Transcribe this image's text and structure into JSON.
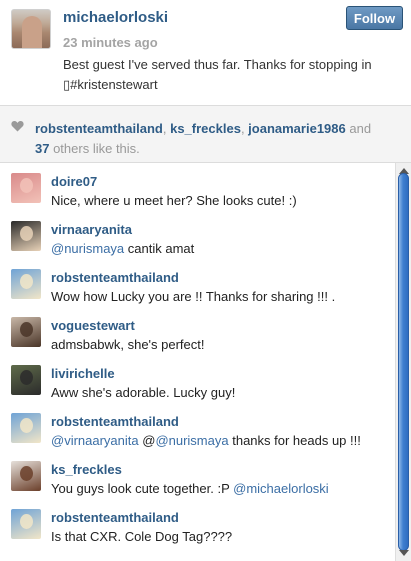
{
  "post": {
    "username": "michaelorloski",
    "time": "23 minutes ago",
    "caption": "Best guest I've served thus far. Thanks for stopping in\n▯#kristenstewart",
    "follow_label": "Follow"
  },
  "likes": {
    "users": [
      "robstenteamthailand",
      "ks_freckles",
      "joanamarie1986"
    ],
    "separator": ", ",
    "and_text": " and",
    "others_count": "37",
    "others_text": " others like this."
  },
  "comments": [
    {
      "user": "doire07",
      "parts": [
        {
          "t": "Nice, where u meet her? She looks cute! :)",
          "m": false
        }
      ],
      "avatar": {
        "bg": "#d98a8a",
        "accent": "#f2c2b8"
      }
    },
    {
      "user": "virnaaryanita",
      "parts": [
        {
          "t": "@nurismaya",
          "m": true
        },
        {
          "t": " cantik amat",
          "m": false
        }
      ],
      "avatar": {
        "bg": "#2a2a2a",
        "accent": "#e8d2b8"
      }
    },
    {
      "user": "robstenteamthailand",
      "parts": [
        {
          "t": "Wow how Lucky you are !! Thanks for sharing !!! .",
          "m": false
        }
      ],
      "avatar": {
        "bg": "#6fa3d6",
        "accent": "#f2e6c8"
      }
    },
    {
      "user": "voguestewart",
      "parts": [
        {
          "t": "admsbabwk, she's perfect!",
          "m": false
        }
      ],
      "avatar": {
        "bg": "#c9b8a8",
        "accent": "#4a3528"
      }
    },
    {
      "user": "livirichelle",
      "parts": [
        {
          "t": "Aww she's adorable. Lucky guy!",
          "m": false
        }
      ],
      "avatar": {
        "bg": "#5f6b4a",
        "accent": "#2b2b2b"
      }
    },
    {
      "user": "robstenteamthailand",
      "parts": [
        {
          "t": "@virnaaryanita",
          "m": true
        },
        {
          "t": " @",
          "m": false
        },
        {
          "t": "@nurismaya",
          "m": true
        },
        {
          "t": " thanks for heads up !!!",
          "m": false
        }
      ],
      "avatar": {
        "bg": "#6fa3d6",
        "accent": "#f2e6c8"
      }
    },
    {
      "user": "ks_freckles",
      "parts": [
        {
          "t": "You guys look cute together. :P ",
          "m": false
        },
        {
          "t": "@michaelorloski",
          "m": true
        }
      ],
      "avatar": {
        "bg": "#e6e0da",
        "accent": "#6b3f2a"
      }
    },
    {
      "user": "robstenteamthailand",
      "parts": [
        {
          "t": "Is that CXR. Cole Dog Tag????",
          "m": false
        }
      ],
      "avatar": {
        "bg": "#6fa3d6",
        "accent": "#f2e6c8"
      }
    }
  ],
  "icons": {
    "heart": "heart-icon",
    "scroll_up": "scroll-up-arrow-icon",
    "scroll_down": "scroll-down-arrow-icon"
  },
  "colors": {
    "username": "#2f5c86",
    "mention": "#3b6ea5",
    "follow_button": "#4a77a4",
    "scroll_thumb": "#3f7fd0"
  }
}
